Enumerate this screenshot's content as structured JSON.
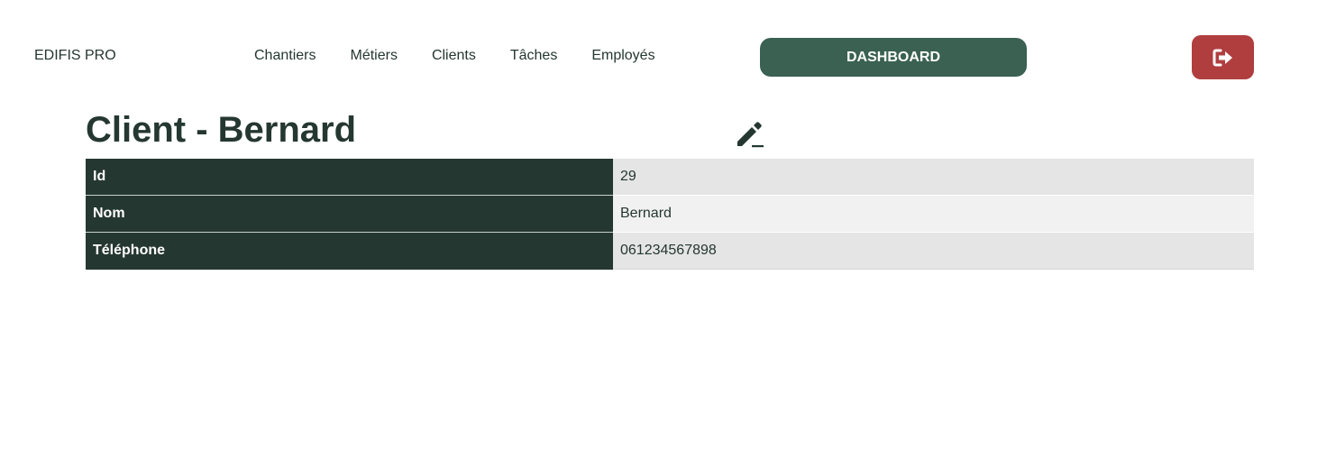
{
  "navbar": {
    "brand": "EDIFIS PRO",
    "links": [
      "Chantiers",
      "Métiers",
      "Clients",
      "Tâches",
      "Employés"
    ],
    "dashboard_label": "DASHBOARD",
    "logout_icon": "sign-out-icon"
  },
  "page": {
    "title": "Client - Bernard",
    "edit_icon": "pencil-icon"
  },
  "details": {
    "rows": [
      {
        "label": "Id",
        "value": "29"
      },
      {
        "label": "Nom",
        "value": "Bernard"
      },
      {
        "label": "Téléphone",
        "value": "061234567898"
      }
    ]
  },
  "colors": {
    "primary_dark": "#253731",
    "dashboard_green": "#3a6152",
    "logout_red": "#b03e3f"
  }
}
